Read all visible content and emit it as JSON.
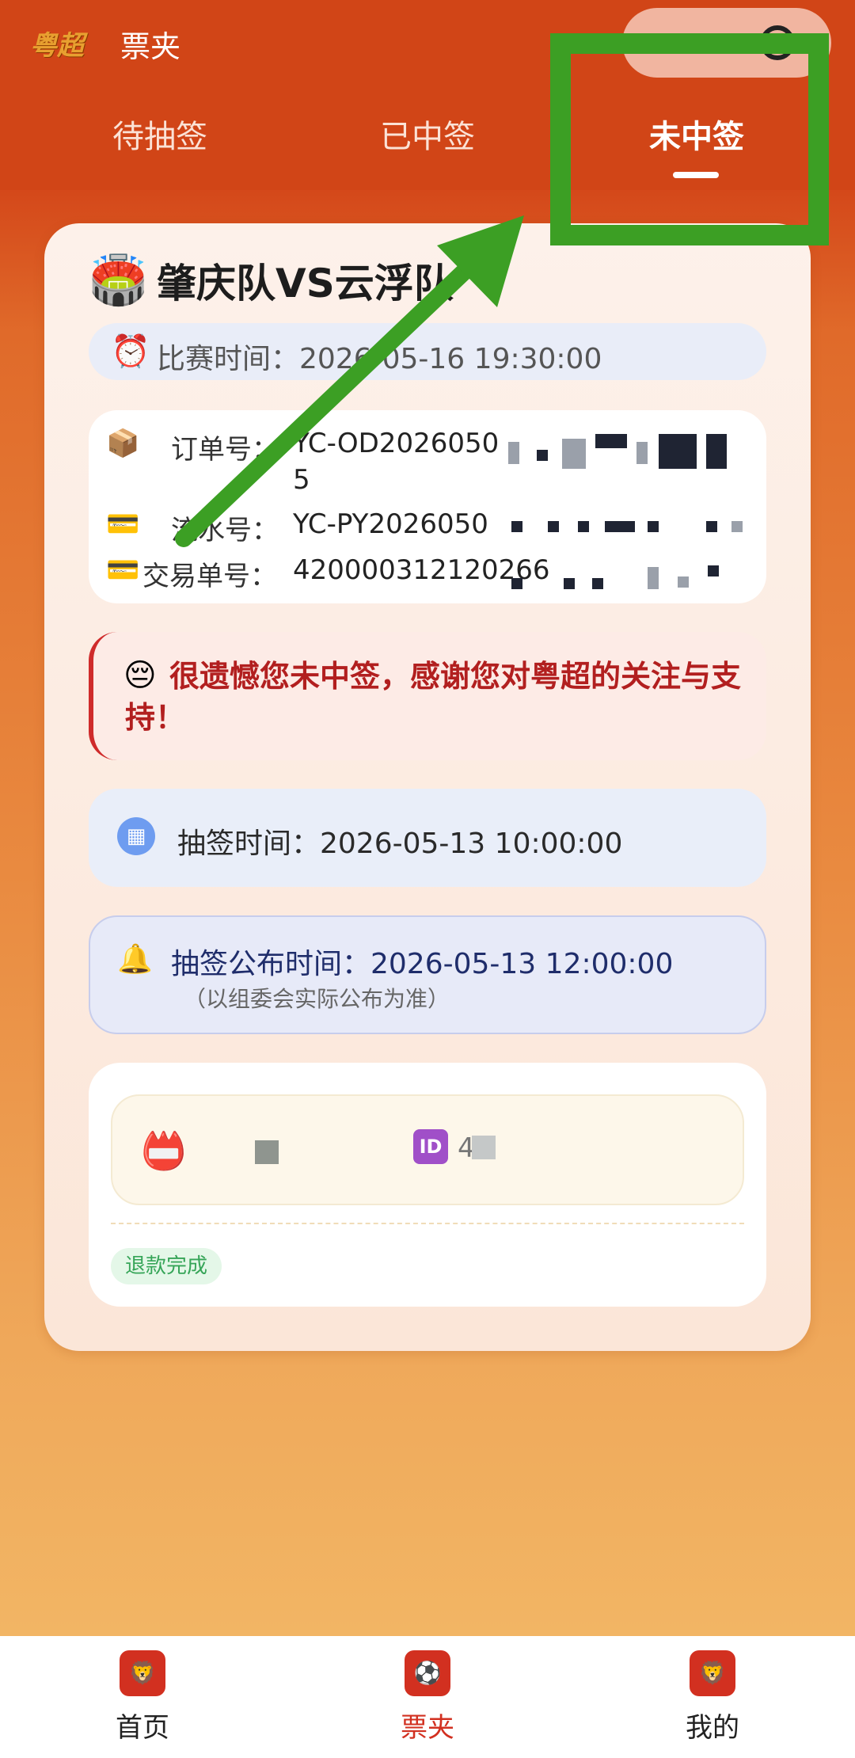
{
  "header": {
    "logo_text": "粤超",
    "title": "票夹"
  },
  "tabs": [
    {
      "label": "待抽签"
    },
    {
      "label": "已中签"
    },
    {
      "label": "未中签"
    }
  ],
  "card": {
    "match_icon": "🏟️",
    "match_title": "肇庆队VS云浮队",
    "match_time_icon": "⏰",
    "match_time": "比赛时间：2026-05-16 19:30:00",
    "order": {
      "rows": [
        {
          "icon": "📦",
          "label": "订单号：",
          "value": "YC-OD2026050",
          "value_line2": "5"
        },
        {
          "icon": "💳",
          "label": "流水号：",
          "value": "YC-PY2026050"
        },
        {
          "icon": "💳",
          "label": "交易单号：",
          "value": "420000312120266"
        }
      ]
    },
    "sorry_icon": "😔",
    "sorry_text": "很遗憾您未中签，感谢您对粤超的关注与支持！",
    "draw_time_icon": "calendar-icon",
    "draw_time": "抽签时间：2026-05-13 10:00:00",
    "publish_icon": "🔔",
    "publish_time": "抽签公布时间：2026-05-13 12:00:00",
    "publish_note": "（以组委会实际公布为准）",
    "ticket": {
      "person_icon": "📛",
      "id_icon": "ID",
      "id_value": "4",
      "status": "退款完成"
    }
  },
  "bottom_nav": [
    {
      "label": "首页",
      "icon": "lion-icon"
    },
    {
      "label": "票夹",
      "icon": "ticket-icon"
    },
    {
      "label": "我的",
      "icon": "lion-icon"
    }
  ],
  "colors": {
    "header": "#d14517",
    "accent": "#d23020",
    "annotation": "#3c9f24"
  }
}
